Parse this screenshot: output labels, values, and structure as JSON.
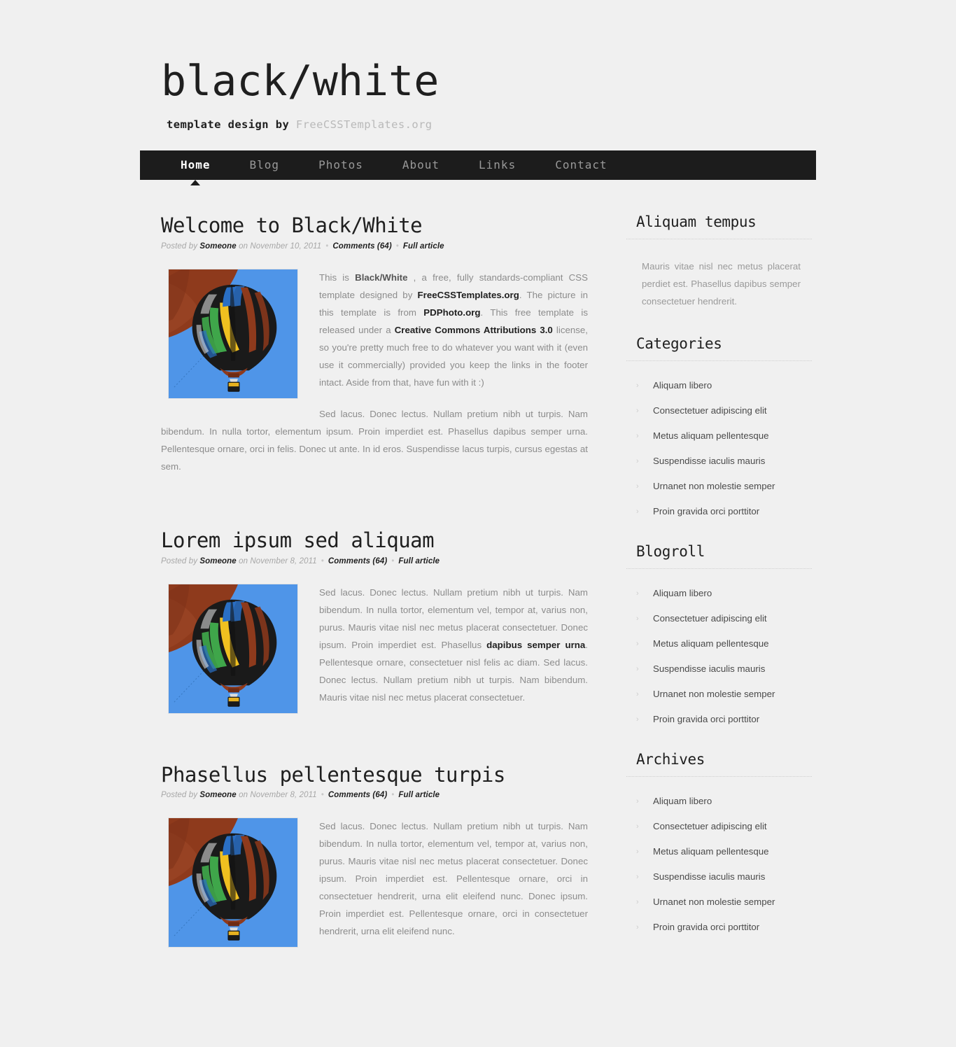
{
  "site": {
    "title": "black/white",
    "tagline_prefix": "template design by ",
    "tagline_link": "FreeCSSTemplates.org"
  },
  "nav": {
    "items": [
      {
        "label": "Home",
        "active": true
      },
      {
        "label": "Blog",
        "active": false
      },
      {
        "label": "Photos",
        "active": false
      },
      {
        "label": "About",
        "active": false
      },
      {
        "label": "Links",
        "active": false
      },
      {
        "label": "Contact",
        "active": false
      }
    ]
  },
  "posts": [
    {
      "title": "Welcome to Black/White",
      "meta": {
        "posted_by_label": "Posted by ",
        "author": "Someone",
        "on_label": " on ",
        "date": "November 10, 2011",
        "comments": "Comments (64)",
        "full_article": "Full article",
        "separator": "•"
      },
      "image_alt": "hot-air-balloon-photo",
      "paragraph1_html": "This is <b>Black/White</b> , a free, fully standards-compliant CSS template designed by <a>FreeCSSTemplates.org</a>. The picture in this template is from <a>PDPhoto.org</a>. This free template is released under a <a>Creative Commons Attributions 3.0</a> license, so you're pretty much free to do whatever you want with it (even use it commercially) provided you keep the links in the footer intact. Aside from that, have fun with it :)",
      "paragraph2_html": "Sed lacus. Donec lectus. Nullam pretium nibh ut turpis. Nam bibendum. In nulla tortor, elementum ipsum. Proin imperdiet est. Phasellus dapibus semper urna. Pellentesque ornare, orci in felis. Donec ut ante. In id eros. Suspendisse lacus turpis, cursus egestas at sem."
    },
    {
      "title": "Lorem ipsum sed aliquam",
      "meta": {
        "posted_by_label": "Posted by ",
        "author": "Someone",
        "on_label": " on ",
        "date": "November 8, 2011",
        "comments": "Comments (64)",
        "full_article": "Full article",
        "separator": "•"
      },
      "image_alt": "hot-air-balloon-photo",
      "paragraph1_html": "Sed lacus. Donec lectus. Nullam pretium nibh ut turpis. Nam bibendum. In nulla tortor, elementum vel, tempor at, varius non, purus. Mauris vitae nisl nec metus placerat consectetuer. Donec ipsum. Proin imperdiet est. Phasellus <a>dapibus semper urna</a>. Pellentesque ornare, consectetuer nisl felis ac diam. Sed lacus. Donec lectus. Nullam pretium nibh ut turpis. Nam bibendum. Mauris vitae nisl nec metus placerat consectetuer.",
      "paragraph2_html": ""
    },
    {
      "title": "Phasellus pellentesque turpis",
      "meta": {
        "posted_by_label": "Posted by ",
        "author": "Someone",
        "on_label": " on ",
        "date": "November 8, 2011",
        "comments": "Comments (64)",
        "full_article": "Full article",
        "separator": "•"
      },
      "image_alt": "hot-air-balloon-photo",
      "paragraph1_html": "Sed lacus. Donec lectus. Nullam pretium nibh ut turpis. Nam bibendum. In nulla tortor, elementum vel, tempor at, varius non, purus. Mauris vitae nisl nec metus placerat consectetuer. Donec ipsum. Proin imperdiet est. Pellentesque ornare, orci in consectetuer hendrerit, urna elit eleifend nunc. Donec ipsum. Proin imperdiet est. Pellentesque ornare, orci in consectetuer hendrerit, urna elit eleifend nunc.",
      "paragraph2_html": ""
    }
  ],
  "sidebar": {
    "blocks": [
      {
        "title": "Aliquam tempus",
        "type": "text",
        "text": "Mauris vitae nisl nec metus placerat perdiet est. Phasellus dapibus semper consectetuer hendrerit.",
        "items": []
      },
      {
        "title": "Categories",
        "type": "list",
        "text": "",
        "items": [
          "Aliquam libero",
          "Consectetuer adipiscing elit",
          "Metus aliquam pellentesque",
          "Suspendisse iaculis mauris",
          "Urnanet non molestie semper",
          "Proin gravida orci porttitor"
        ]
      },
      {
        "title": "Blogroll",
        "type": "list",
        "text": "",
        "items": [
          "Aliquam libero",
          "Consectetuer adipiscing elit",
          "Metus aliquam pellentesque",
          "Suspendisse iaculis mauris",
          "Urnanet non molestie semper",
          "Proin gravida orci porttitor"
        ]
      },
      {
        "title": "Archives",
        "type": "list",
        "text": "",
        "items": [
          "Aliquam libero",
          "Consectetuer adipiscing elit",
          "Metus aliquam pellentesque",
          "Suspendisse iaculis mauris",
          "Urnanet non molestie semper",
          "Proin gravida orci porttitor"
        ]
      }
    ],
    "bullet_glyph": "›"
  },
  "colors": {
    "page_bg": "#f0f0f0",
    "nav_bg": "#1c1c1c",
    "text": "#8c8c8c",
    "heading": "#1f1f1f",
    "link": "#1f1f1f",
    "sky": "#4f95e8",
    "balloon_dark": "#191919",
    "balloon_rust": "#8c3a1e",
    "balloon_green": "#3fa64a",
    "balloon_yellow": "#f0c020",
    "balloon_blue": "#2a6fc4"
  }
}
